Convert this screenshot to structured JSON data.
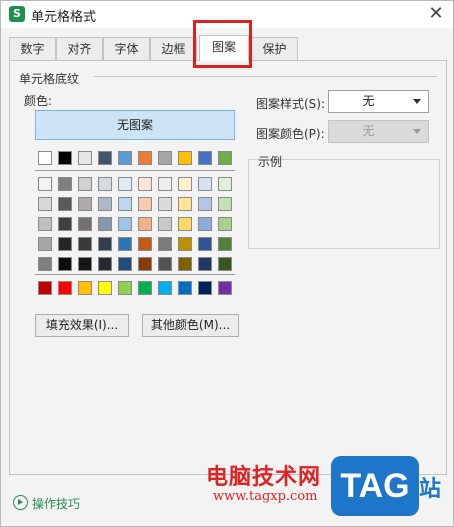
{
  "window": {
    "title": "单元格格式",
    "app_icon_letter": "S",
    "close_glyph": "✕"
  },
  "tabs": [
    {
      "label": "数字",
      "active": false
    },
    {
      "label": "对齐",
      "active": false
    },
    {
      "label": "字体",
      "active": false
    },
    {
      "label": "边框",
      "active": false
    },
    {
      "label": "图案",
      "active": true
    },
    {
      "label": "保护",
      "active": false
    }
  ],
  "shading": {
    "group_title": "单元格底纹",
    "color_label": "颜色:",
    "no_pattern_label": "无图案",
    "theme_top_row": [
      "#ffffff",
      "#000000",
      "#e7e6e6",
      "#44546a",
      "#5b9bd5",
      "#ed7d31",
      "#a5a5a5",
      "#ffc000",
      "#4472c4",
      "#70ad47"
    ],
    "theme_shades": [
      [
        "#f2f2f2",
        "#7f7f7f",
        "#d0cece",
        "#d6dce4",
        "#deebf6",
        "#fbe5d5",
        "#ededed",
        "#fff2cc",
        "#d9e2f3",
        "#e2efd9"
      ],
      [
        "#d8d8d8",
        "#595959",
        "#aeaaaa",
        "#adb9ca",
        "#bdd7ee",
        "#f7cbac",
        "#dbdbdb",
        "#fee599",
        "#b4c6e7",
        "#c5e0b3"
      ],
      [
        "#bfbfbf",
        "#3f3f3f",
        "#757070",
        "#8496b0",
        "#9dc3e6",
        "#f4b183",
        "#c9c9c9",
        "#ffd965",
        "#8eaadb",
        "#a8d08d"
      ],
      [
        "#a5a5a5",
        "#262626",
        "#3a3838",
        "#323f4f",
        "#2e75b5",
        "#c55a11",
        "#7b7b7b",
        "#bf9000",
        "#2f5496",
        "#538135"
      ],
      [
        "#7f7f7f",
        "#0c0c0c",
        "#171616",
        "#222a35",
        "#1e4e79",
        "#843c0b",
        "#525252",
        "#7f6000",
        "#1f3864",
        "#375623"
      ]
    ],
    "standard_colors": [
      "#c00000",
      "#ff0000",
      "#ffc000",
      "#ffff00",
      "#92d050",
      "#00b050",
      "#00b0f0",
      "#0070c0",
      "#002060",
      "#7030a0"
    ],
    "fill_effects_label": "填充效果(I)...",
    "more_colors_label": "其他颜色(M)..."
  },
  "pattern": {
    "style_label": "图案样式(S):",
    "style_value": "无",
    "color_label": "图案颜色(P):",
    "color_value": "无"
  },
  "sample": {
    "label": "示例"
  },
  "footer": {
    "tips_label": "操作技巧"
  },
  "watermark": {
    "text": "电脑技术网",
    "url": "www.tagxp.com",
    "logo": "TAG",
    "site": "站"
  }
}
